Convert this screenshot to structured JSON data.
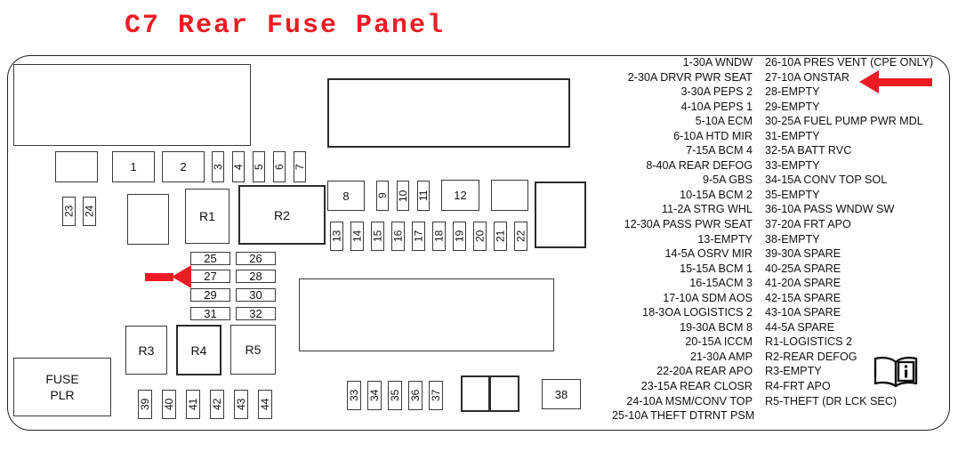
{
  "title": "C7 Rear Fuse Panel",
  "accent_color": "#ed1c24",
  "arrow_color": "#ee1b24",
  "diagram": {
    "relay_labels": {
      "r1": "R1",
      "r2": "R2",
      "r3": "R3",
      "r4": "R4",
      "r5": "R5"
    },
    "fuse_puller": {
      "line1": "FUSE",
      "line2": "PLR"
    },
    "horizontal_fuses": [
      "1",
      "2",
      "8",
      "12",
      "38"
    ],
    "vertical_fuses_top": [
      "3",
      "4",
      "5",
      "6",
      "7"
    ],
    "vertical_fuses_side": [
      "23",
      "24"
    ],
    "vertical_fuses_row9": [
      "9",
      "10",
      "11"
    ],
    "vertical_fuses_row13": [
      "13",
      "14",
      "15",
      "16",
      "17",
      "18",
      "19",
      "20",
      "21",
      "22"
    ],
    "grid_fuses": [
      "25",
      "26",
      "27",
      "28",
      "29",
      "30",
      "31",
      "32"
    ],
    "vertical_fuses_bottom": [
      "33",
      "34",
      "35",
      "36",
      "37"
    ],
    "vertical_fuses_relay_row": [
      "39",
      "40",
      "41",
      "42",
      "43",
      "44"
    ]
  },
  "legend": {
    "left_column": [
      "1-30A WNDW",
      "2-30A DRVR PWR SEAT",
      "3-30A PEPS 2",
      "4-10A PEPS 1",
      "5-10A ECM",
      "6-10A HTD MIR",
      "7-15A BCM 4",
      "8-40A REAR DEFOG",
      "9-5A GBS",
      "10-15A BCM 2",
      "11-2A STRG WHL",
      "12-30A PASS PWR SEAT",
      "13-EMPTY",
      "14-5A OSRV MIR",
      "15-15A BCM 1",
      "16-15ACM 3",
      "17-10A SDM AOS",
      "18-3OA LOGISTICS 2",
      "19-30A BCM 8",
      "20-15A ICCM",
      "21-30A AMP",
      "22-20A REAR APO",
      "23-15A REAR CLOSR",
      "24-10A MSM/CONV TOP",
      "25-10A THEFT DTRNT PSM"
    ],
    "right_column": [
      "26-10A PRES VENT (CPE ONLY)",
      "27-10A ONSTAR",
      "28-EMPTY",
      "29-EMPTY",
      "30-25A FUEL PUMP PWR MDL",
      "31-EMPTY",
      "32-5A BATT RVC",
      "33-EMPTY",
      "34-15A CONV TOP SOL",
      "35-EMPTY",
      "36-10A PASS WNDW SW",
      "37-20A FRT APO",
      "38-EMPTY",
      "39-30A SPARE",
      "40-25A SPARE",
      "41-20A SPARE",
      "42-15A SPARE",
      "43-10A SPARE",
      "44-5A SPARE",
      "R1-LOGISTICS 2",
      "R2-REAR DEFOG",
      "R3-EMPTY",
      "R4-FRT APO",
      "R5-THEFT (DR LCK SEC)"
    ]
  }
}
